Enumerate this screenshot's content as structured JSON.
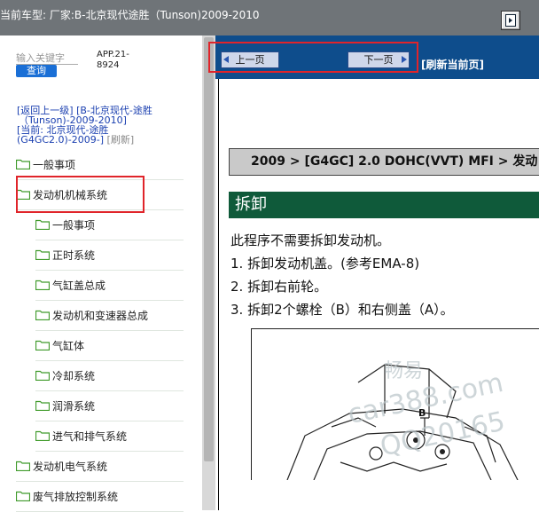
{
  "topbar": {
    "title": "当前车型:  厂家:B-北京现代途胜（Tunson)2009-2010"
  },
  "sidebar": {
    "search_placeholder": "输入关键字",
    "search_button": "查询",
    "app_id_line1": "APP.21-",
    "app_id_line2": "8924",
    "back_link_line1": "[返回上一级]   [B-北京现代-途胜",
    "back_link_line2": "（Tunson)-2009-2010]",
    "current_line1": "[当前: 北京现代-途胜",
    "current_line2": "(G4GC2.0)-2009-]",
    "refresh_label": "[刷新]",
    "items": [
      {
        "label": "一般事项",
        "level": 0
      },
      {
        "label": "发动机机械系统",
        "level": 0
      },
      {
        "label": "一般事项",
        "level": 1
      },
      {
        "label": "正时系统",
        "level": 1
      },
      {
        "label": "气缸盖总成",
        "level": 1
      },
      {
        "label": "发动机和变速器总成",
        "level": 1
      },
      {
        "label": "气缸体",
        "level": 1
      },
      {
        "label": "冷却系统",
        "level": 1
      },
      {
        "label": "润滑系统",
        "level": 1
      },
      {
        "label": "进气和排气系统",
        "level": 1
      },
      {
        "label": "发动机电气系统",
        "level": 0
      },
      {
        "label": "废气排放控制系统",
        "level": 0
      }
    ]
  },
  "main": {
    "prev_button": "上一页",
    "next_button": "下一页",
    "refresh_page": "[刷新当前页]",
    "breadcrumb": "2009 > [G4GC] 2.0 DOHC(VVT) MFI > 发动",
    "section_title": "拆卸",
    "intro": "此程序不需要拆卸发动机。",
    "steps": [
      "1. 拆卸发动机盖。(参考EMA-8)",
      "2. 拆卸右前轮。",
      "3. 拆卸2个螺栓（B）和右侧盖（A）。"
    ],
    "diagram_label": "B",
    "watermark_lines": [
      "畅易",
      "car388.com",
      "QQ20165"
    ]
  },
  "colors": {
    "topbar": "#6f7478",
    "toolbar": "#0e4d8c",
    "section_title": "#0f5a3a",
    "highlight": "#e0242a",
    "folder": "#3f9a2a"
  }
}
